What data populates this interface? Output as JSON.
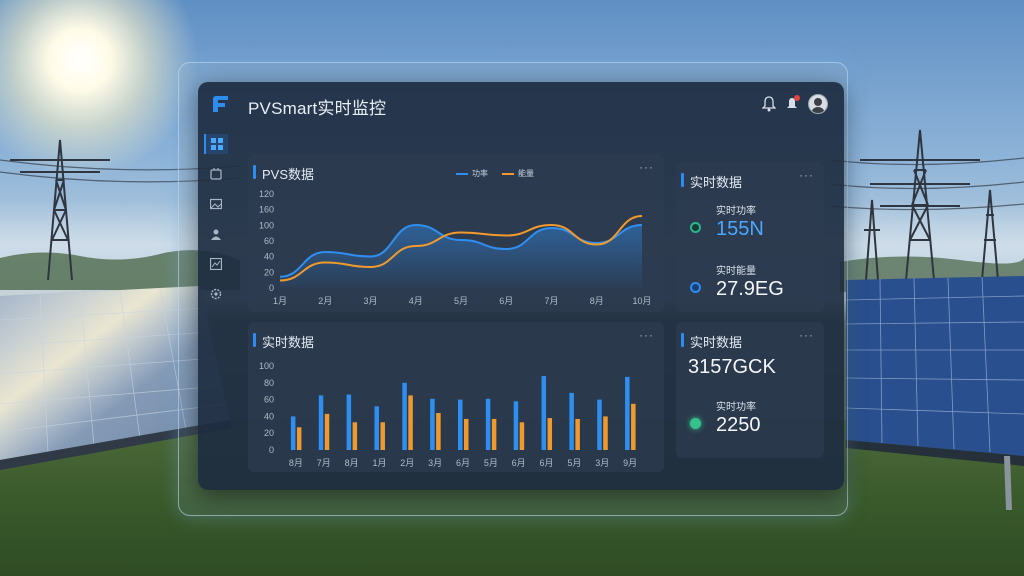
{
  "app": {
    "title": "PVSmart实时监控"
  },
  "header": {
    "bell_icon": "bell-icon",
    "alert_icon": "alert-icon",
    "avatar": "user-avatar"
  },
  "sidebar": {
    "items": [
      {
        "icon": "grid-icon",
        "active": true
      },
      {
        "icon": "device-icon"
      },
      {
        "icon": "image-icon"
      },
      {
        "icon": "users-icon"
      },
      {
        "icon": "chart-icon"
      },
      {
        "icon": "settings-icon"
      }
    ]
  },
  "line_card": {
    "title": "PVS数据",
    "more": "···"
  },
  "bar_card": {
    "title": "实时数据",
    "more": "···"
  },
  "stats_top": {
    "title": "实时数据",
    "more": "···",
    "items": [
      {
        "label": "实时功率",
        "value": "155N"
      },
      {
        "label": "实时能量",
        "value": "27.9EG"
      }
    ]
  },
  "stats_bottom": {
    "title": "实时数据",
    "more": "···",
    "value_main": "3157GCK",
    "item": {
      "label": "实时功率",
      "value": "2250"
    }
  },
  "colors": {
    "blue": "#2f8ff0",
    "orange": "#f09a2e",
    "accent": "#2d8cf0",
    "green": "#35c28a"
  },
  "chart_data": [
    {
      "type": "line",
      "title": "PVS数据",
      "categories": [
        "1月",
        "2月",
        "3月",
        "4月",
        "5月",
        "6月",
        "7月",
        "8月",
        "10月"
      ],
      "y_ticks": [
        0,
        20,
        40,
        60,
        100,
        160,
        120
      ],
      "ylim": [
        0,
        120
      ],
      "legend": "top-center",
      "grid": false,
      "series": [
        {
          "name": "功率",
          "color": "#2f8ff0",
          "values": [
            15,
            48,
            42,
            84,
            64,
            52,
            80,
            60,
            84
          ],
          "fill": true
        },
        {
          "name": "能量",
          "color": "#f09a2e",
          "values": [
            10,
            34,
            28,
            56,
            74,
            70,
            84,
            58,
            96
          ]
        }
      ]
    },
    {
      "type": "bar",
      "title": "实时数据",
      "categories": [
        "8月",
        "7月",
        "8月",
        "1月",
        "2月",
        "3月",
        "6月",
        "5月",
        "6月",
        "6月",
        "5月",
        "3月",
        "9月"
      ],
      "y_ticks": [
        0,
        20,
        40,
        60,
        80,
        100
      ],
      "ylim": [
        0,
        100
      ],
      "grid": false,
      "series": [
        {
          "color": "#2f8ff0",
          "values": [
            40,
            65,
            66,
            52,
            80,
            61,
            60,
            61,
            58,
            88,
            68,
            60,
            87
          ]
        },
        {
          "color": "#f09a2e",
          "values": [
            27,
            43,
            33,
            33,
            65,
            44,
            37,
            37,
            33,
            38,
            37,
            40,
            55
          ]
        }
      ]
    }
  ]
}
